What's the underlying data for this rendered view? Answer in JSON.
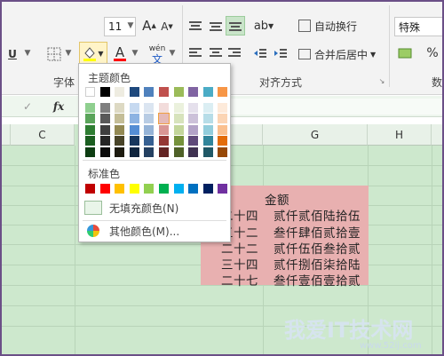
{
  "ribbon": {
    "font_size": "11",
    "font_name": "特殊",
    "grow_font": "A",
    "shrink_font": "A",
    "underline": "U",
    "font_color_glyph": "A",
    "phonetic_glyph": "wén",
    "phonetic_sub": "文",
    "wrap_text": "自动换行",
    "merge_center": "合并后居中",
    "group_font": "字体",
    "group_align": "对齐方式",
    "group_number": "数"
  },
  "formula_bar": {
    "fx": "fx",
    "check": "✓"
  },
  "columns": [
    "C",
    "G",
    "H"
  ],
  "cells": {
    "header": "金额",
    "rows": [
      {
        "num": "二十四",
        "amount": "贰仟贰佰陆拾伍"
      },
      {
        "num": "三十二",
        "amount": "叁仟肆佰贰拾壹"
      },
      {
        "num": "二十二",
        "amount": "贰仟伍佰叁拾贰"
      },
      {
        "num": "三十四",
        "amount": "贰仟捌佰柒拾陆"
      },
      {
        "num": "二十七",
        "amount": "叁仟壹佰壹拾贰"
      }
    ]
  },
  "fill_dropdown": {
    "theme_title": "主题颜色",
    "standard_title": "标准色",
    "no_fill": "无填充颜色(N)",
    "more_colors": "其他颜色(M)...",
    "theme_top": [
      "#ffffff",
      "#000000",
      "#eeece1",
      "#1f497d",
      "#4f81bd",
      "#c0504d",
      "#9bbb59",
      "#8064a2",
      "#4bacc6",
      "#f79646"
    ],
    "theme_shades": [
      [
        "#8fcf8f",
        "#7f7f7f",
        "#ddd9c3",
        "#c6d9f0",
        "#dbe5f1",
        "#f2dcdb",
        "#ebf1dd",
        "#e5e0ec",
        "#dbeef3",
        "#fdeada"
      ],
      [
        "#5aa45a",
        "#595959",
        "#c4bd97",
        "#8db3e2",
        "#b8cce4",
        "#e5b9b7",
        "#d7e3bc",
        "#ccc1d9",
        "#b7dde8",
        "#fbd5b5"
      ],
      [
        "#2e7d32",
        "#3f3f3f",
        "#938953",
        "#548dd4",
        "#95b3d7",
        "#d99694",
        "#c3d69b",
        "#b2a2c7",
        "#92cddc",
        "#fac08f"
      ],
      [
        "#1b5e20",
        "#262626",
        "#494429",
        "#17365d",
        "#366092",
        "#953734",
        "#76923c",
        "#5f497a",
        "#31859b",
        "#e36c09"
      ],
      [
        "#0d3d12",
        "#0c0c0c",
        "#1d1b10",
        "#0f243e",
        "#244061",
        "#632423",
        "#4f6128",
        "#3f3151",
        "#205867",
        "#974806"
      ]
    ],
    "standard": [
      "#c00000",
      "#ff0000",
      "#ffc000",
      "#ffff00",
      "#92d050",
      "#00b050",
      "#00b0f0",
      "#0070c0",
      "#002060",
      "#7030a0"
    ]
  },
  "watermark": {
    "text": "我爱IT技术网",
    "url": "www.52ij.com"
  }
}
